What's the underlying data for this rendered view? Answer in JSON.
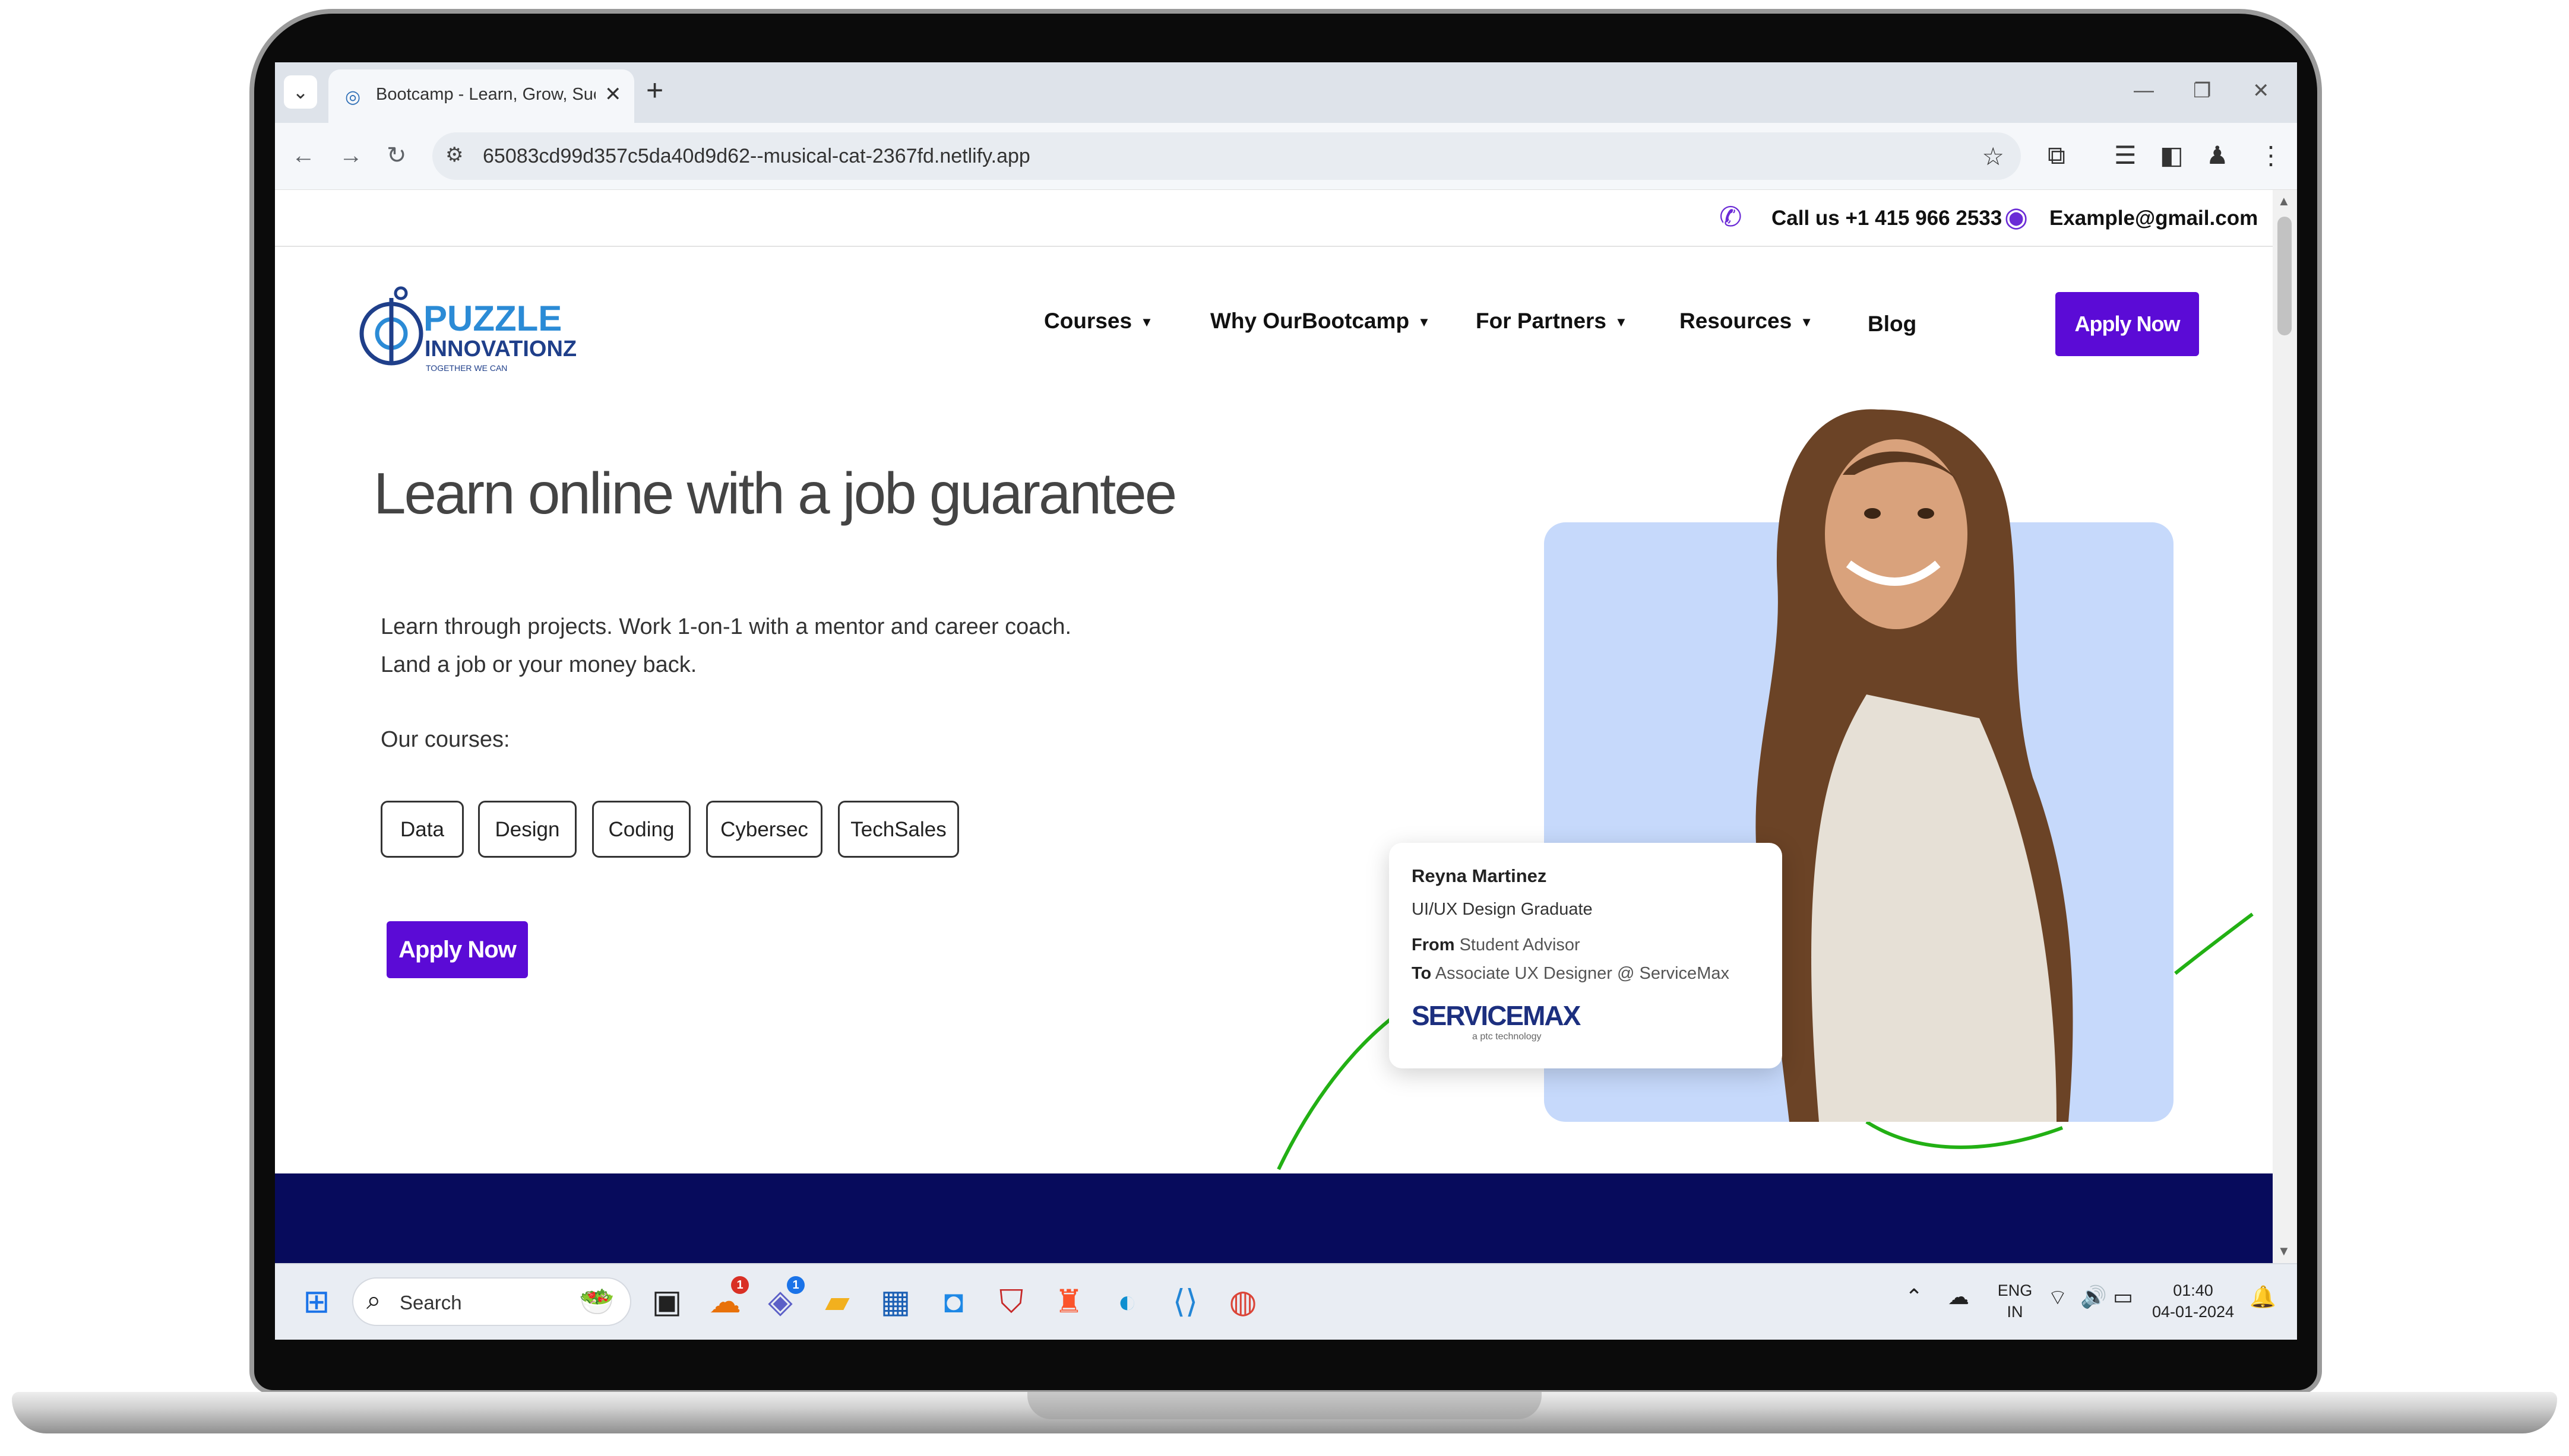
{
  "browser": {
    "tab_title": "Bootcamp - Learn, Grow, Succe",
    "url": "65083cd99d357c5da40d9d62--musical-cat-2367fd.netlify.app"
  },
  "topbar": {
    "phone_text": "Call us +1 415 966 2533",
    "email_text": "Example@gmail.com"
  },
  "logo": {
    "line1": "PUZZLE",
    "line2": "INNOVATIONZ",
    "tagline": "TOGETHER WE CAN"
  },
  "nav": {
    "items": [
      {
        "label": "Courses"
      },
      {
        "label": "Why OurBootcamp"
      },
      {
        "label": "For Partners"
      },
      {
        "label": "Resources"
      },
      {
        "label": "Blog"
      }
    ],
    "apply_label": "Apply Now"
  },
  "hero": {
    "title": "Learn online with a job guarantee",
    "subtitle_line1": "Learn through projects. Work 1-on-1 with a mentor and career coach.",
    "subtitle_line2": "Land a job or your money back.",
    "courses_label": "Our courses:",
    "courses": [
      "Data",
      "Design",
      "Coding",
      "Cybersec",
      "TechSales"
    ],
    "apply_label": "Apply Now"
  },
  "testimonial": {
    "name": "Reyna Martinez",
    "role": "UI/UX Design Graduate",
    "from_label": "From",
    "from_value": "Student Advisor",
    "to_label": "To",
    "to_value": "Associate UX Designer @ ServiceMax",
    "brand": "SERVICEMAX",
    "brand_sub": "a ptc technology"
  },
  "taskbar": {
    "search_placeholder": "Search",
    "badge_1": "1",
    "badge_2": "1",
    "lang_line1": "ENG",
    "lang_line2": "IN",
    "time": "01:40",
    "date": "04-01-2024"
  },
  "colors": {
    "accent": "#5b0bd6",
    "navy": "#070b5c",
    "photo_bg": "#c6d9fb",
    "green_arc": "#22b014"
  }
}
